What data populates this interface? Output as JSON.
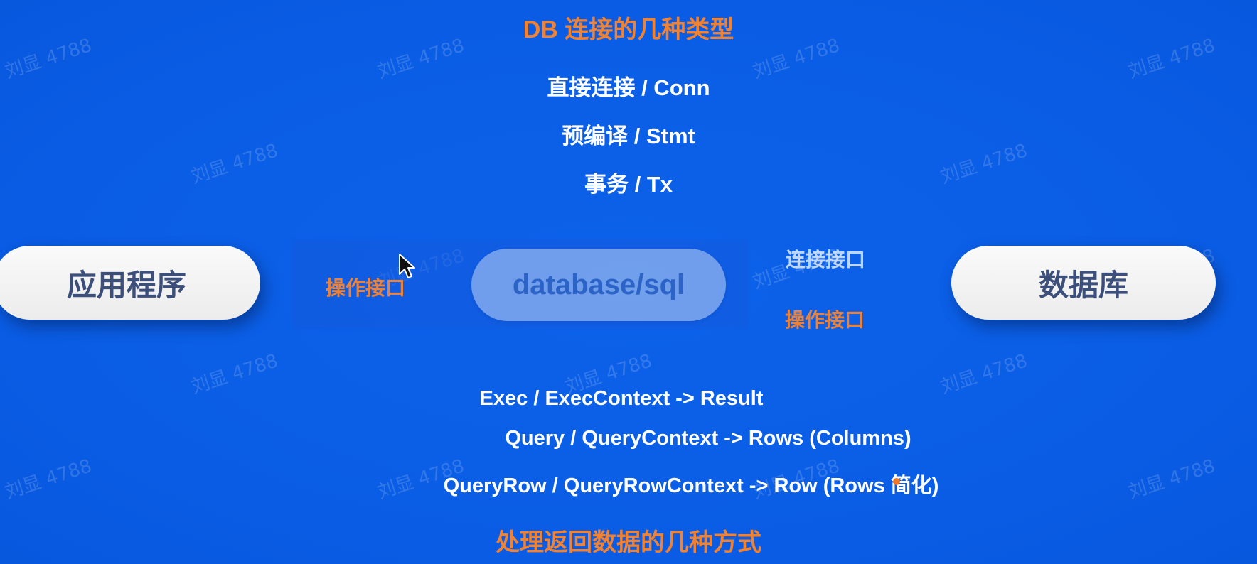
{
  "title_top": "DB 连接的几种类型",
  "connection_types": [
    "直接连接 / Conn",
    "预编译 / Stmt",
    "事务 / Tx"
  ],
  "nodes": {
    "app": "应用程序",
    "center": "database/sql",
    "database": "数据库"
  },
  "labels": {
    "op_interface_left": "操作接口",
    "conn_interface": "连接接口",
    "op_interface_right": "操作接口"
  },
  "operations": [
    "Exec / ExecContext -> Result",
    "Query / QueryContext -> Rows (Columns)",
    "QueryRow / QueryRowContext -> Row (Rows 简化)"
  ],
  "title_bottom": "处理返回数据的几种方式",
  "watermark_text": "刘显 4788",
  "colors": {
    "background": "#0a5ee6",
    "accent_orange": "#f08232",
    "pill_text": "#3c4f7a",
    "sql_text": "#2c63c6"
  }
}
